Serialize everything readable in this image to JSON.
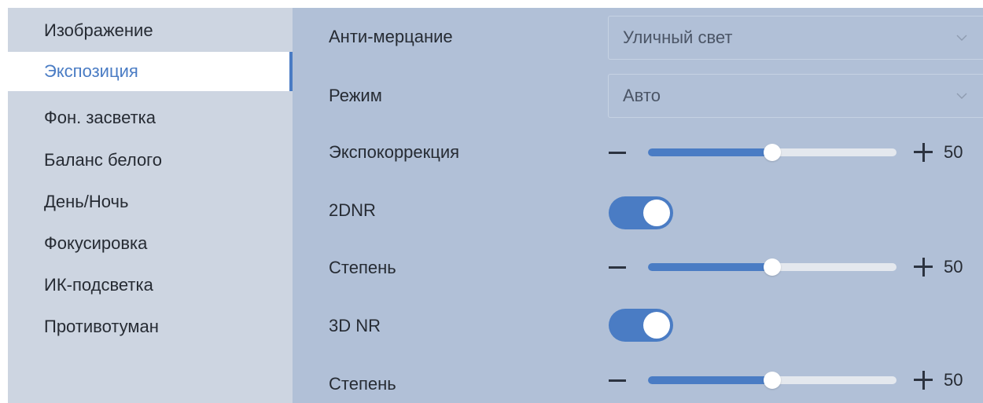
{
  "sidebar": {
    "items": [
      {
        "label": "Изображение",
        "active": false
      },
      {
        "label": "Экспозиция",
        "active": true
      },
      {
        "label": "Фон. засветка",
        "active": false
      },
      {
        "label": "Баланс белого",
        "active": false
      },
      {
        "label": "День/Ночь",
        "active": false
      },
      {
        "label": "Фокусировка",
        "active": false
      },
      {
        "label": "ИК-подсветка",
        "active": false
      },
      {
        "label": "Противотуман",
        "active": false
      }
    ]
  },
  "settings": {
    "anti_flicker": {
      "label": "Анти-мерцание",
      "value": "Уличный свет"
    },
    "mode": {
      "label": "Режим",
      "value": "Авто"
    },
    "exposure_comp": {
      "label": "Экспокоррекция",
      "value": "50",
      "fraction": 0.5
    },
    "dnr2": {
      "label": "2DNR",
      "on": true
    },
    "dnr2_level": {
      "label": "Степень",
      "value": "50",
      "fraction": 0.5
    },
    "dnr3": {
      "label": "3D NR",
      "on": true
    },
    "dnr3_level": {
      "label": "Степень",
      "value": "50",
      "fraction": 0.5
    }
  },
  "colors": {
    "accent": "#4a7cc4",
    "sidebar_bg": "#cdd5e1",
    "panel_bg": "#b1c0d7"
  },
  "icons": {
    "dropdown": "chevron-down-icon",
    "decrease": "minus-icon",
    "increase": "plus-icon"
  }
}
